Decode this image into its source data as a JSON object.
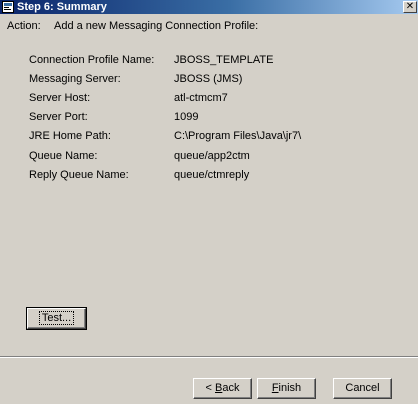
{
  "window": {
    "title": "Step 6: Summary",
    "close_symbol": "✕"
  },
  "action": {
    "label": "Action:",
    "text": "Add a new Messaging Connection Profile:"
  },
  "fields": [
    {
      "label": "Connection Profile Name:",
      "value": "JBOSS_TEMPLATE"
    },
    {
      "label": "Messaging Server:",
      "value": "JBOSS (JMS)"
    },
    {
      "label": "Server Host:",
      "value": "atl-ctmcm7"
    },
    {
      "label": "Server Port:",
      "value": "1099"
    },
    {
      "label": "JRE Home Path:",
      "value": "C:\\Program Files\\Java\\jr7\\"
    },
    {
      "label": "Queue Name:",
      "value": "queue/app2ctm"
    },
    {
      "label": "Reply Queue Name:",
      "value": "queue/ctmreply"
    }
  ],
  "buttons": {
    "test": "Test...",
    "back_mnemonic": "B",
    "back_rest": "ack",
    "back_prefix": "< ",
    "finish_mnemonic": "F",
    "finish_rest": "inish",
    "cancel": "Cancel"
  },
  "icons": {
    "title_icon": "wizard-icon"
  }
}
